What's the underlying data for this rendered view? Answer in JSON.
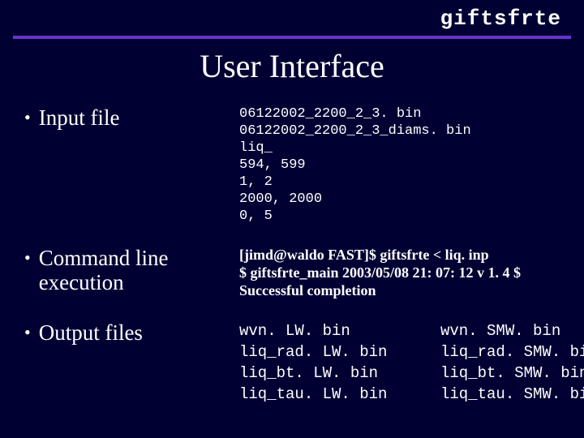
{
  "header": {
    "brand": "giftsfrte"
  },
  "title": "User Interface",
  "bullets": {
    "input": "Input file",
    "cmd": "Command line execution",
    "output": "Output files"
  },
  "input_block": "06122002_2200_2_3. bin\n06122002_2200_2_3_diams. bin\nliq_\n594, 599\n1, 2\n2000, 2000\n0, 5",
  "cmd_block": {
    "line1": "[jimd@waldo FAST]$ giftsfrte < liq. inp",
    "line2": "$ giftsfrte_main 2003/05/08 21: 07: 12  v 1. 4 $",
    "line3": "Successful completion"
  },
  "output_left": "wvn. LW. bin\nliq_rad. LW. bin\nliq_bt. LW. bin\nliq_tau. LW. bin",
  "output_right": "wvn. SMW. bin\nliq_rad. SMW. bin\nliq_bt. SMW. bin\nliq_tau. SMW. bin"
}
